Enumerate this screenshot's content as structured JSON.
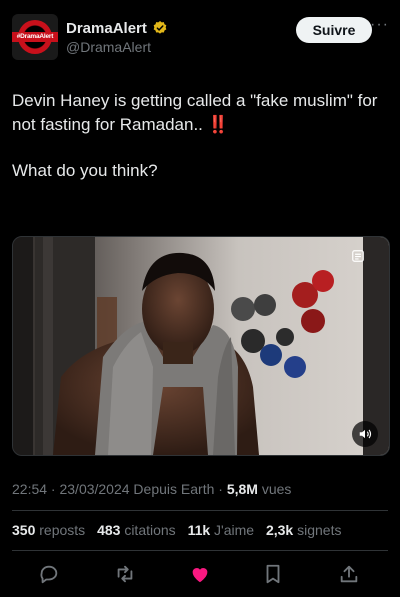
{
  "tweet": {
    "author": {
      "name": "DramaAlert",
      "handle": "@DramaAlert",
      "avatar_text": "#DramaAlert",
      "verified": true
    },
    "follow_label": "Suivre",
    "more_icon": "more-horizontal-icon",
    "body": {
      "line1": "Devin Haney is getting called a \"fake muslim\" for not fasting for Ramadan.. ",
      "alarm": "‼️",
      "line2": "What do you think?"
    },
    "meta": {
      "time_date": "22:54 · 23/03/2024 Depuis Earth · ",
      "views_count": "5,8M",
      "views_label": " vues"
    },
    "stats": {
      "reposts_count": "350",
      "reposts_label": "reposts",
      "quotes_count": "483",
      "quotes_label": "citations",
      "likes_count": "11k",
      "likes_label": "J'aime",
      "bookmarks_count": "2,3k",
      "bookmarks_label": "signets"
    },
    "actions": [
      "reply-icon",
      "repost-icon",
      "like-icon",
      "bookmark-icon",
      "share-icon"
    ],
    "colors": {
      "background": "#000000",
      "text": "#e7e9ea",
      "muted": "#71767b",
      "like": "#f91880",
      "verified": "#e2b719",
      "brand_red": "#c8101b"
    }
  }
}
